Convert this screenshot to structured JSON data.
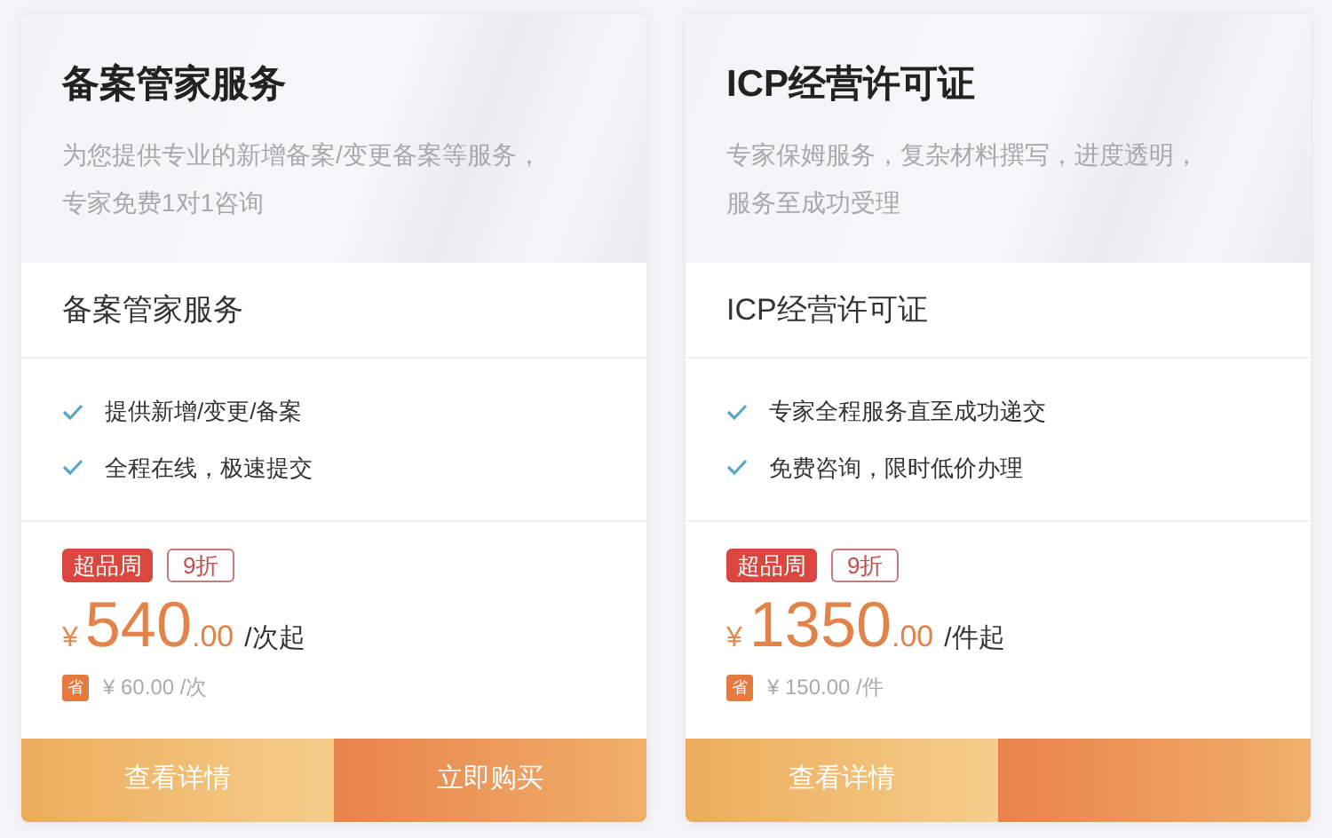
{
  "cards": [
    {
      "title": "备案管家服务",
      "description": "为您提供专业的新增备案/变更备案等服务，专家免费1对1咨询",
      "plan": "备案管家服务",
      "features": [
        "提供新增/变更/备案",
        "全程在线，极速提交"
      ],
      "tags": [
        {
          "label": "超品周",
          "kind": "filled"
        },
        {
          "label": "9折",
          "kind": "outline"
        }
      ],
      "currency": "¥",
      "price": "540",
      "cents": ".00",
      "unit": "/次起",
      "save_mark": "省",
      "save": "¥ 60.00 /次",
      "buttons": [
        {
          "label": "查看详情",
          "kind": "details"
        },
        {
          "kind": "buy",
          "label": "立即购买"
        }
      ]
    },
    {
      "title": "ICP经营许可证",
      "description": "专家保姆服务，复杂材料撰写，进度透明，服务至成功受理",
      "plan": "ICP经营许可证",
      "features": [
        "专家全程服务直至成功递交",
        "免费咨询，限时低价办理"
      ],
      "tags": [
        {
          "label": "超品周",
          "kind": "filled"
        },
        {
          "label": "9折",
          "kind": "outline"
        }
      ],
      "currency": "¥",
      "price": "1350",
      "cents": ".00",
      "unit": "/件起",
      "save_mark": "省",
      "save": "¥ 150.00 /件",
      "buttons": [
        {
          "label": "查看详情",
          "kind": "details"
        },
        {
          "kind": "buy"
        }
      ]
    }
  ]
}
